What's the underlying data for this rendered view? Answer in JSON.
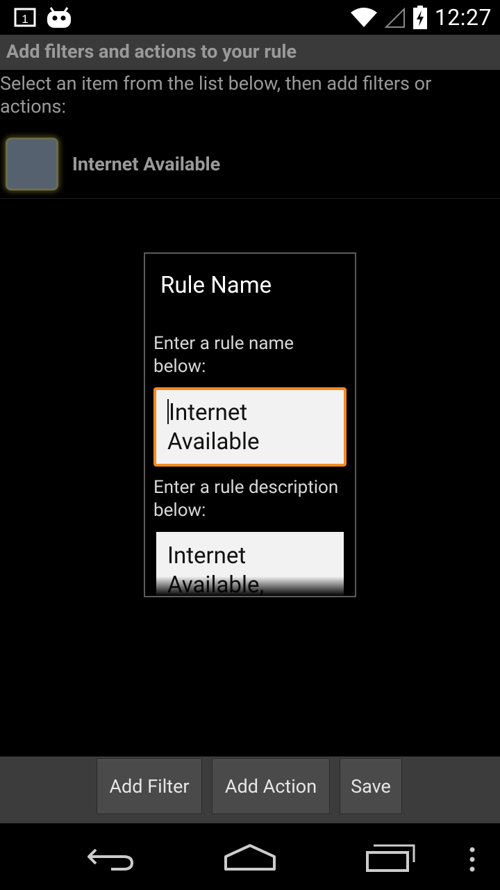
{
  "status_bar": {
    "notification_count": "1",
    "time": "12:27"
  },
  "title_bar": {
    "title": "Add filters and actions to your rule"
  },
  "instruction": "Select an item from the list below, then add filters or actions:",
  "list": {
    "items": [
      {
        "label": "Internet Available"
      }
    ]
  },
  "dialog": {
    "title": "Rule Name",
    "name_prompt": "Enter a rule name below:",
    "name_value": "Internet Available",
    "description_prompt": "Enter a rule description below:",
    "description_value": "Internet Available,"
  },
  "buttons": {
    "add_filter": "Add Filter",
    "add_action": "Add Action",
    "save": "Save"
  },
  "colors": {
    "accent_focus": "#f28a1e",
    "title_bar": "#3a3a3a",
    "button_bar": "#3c3c3c"
  }
}
